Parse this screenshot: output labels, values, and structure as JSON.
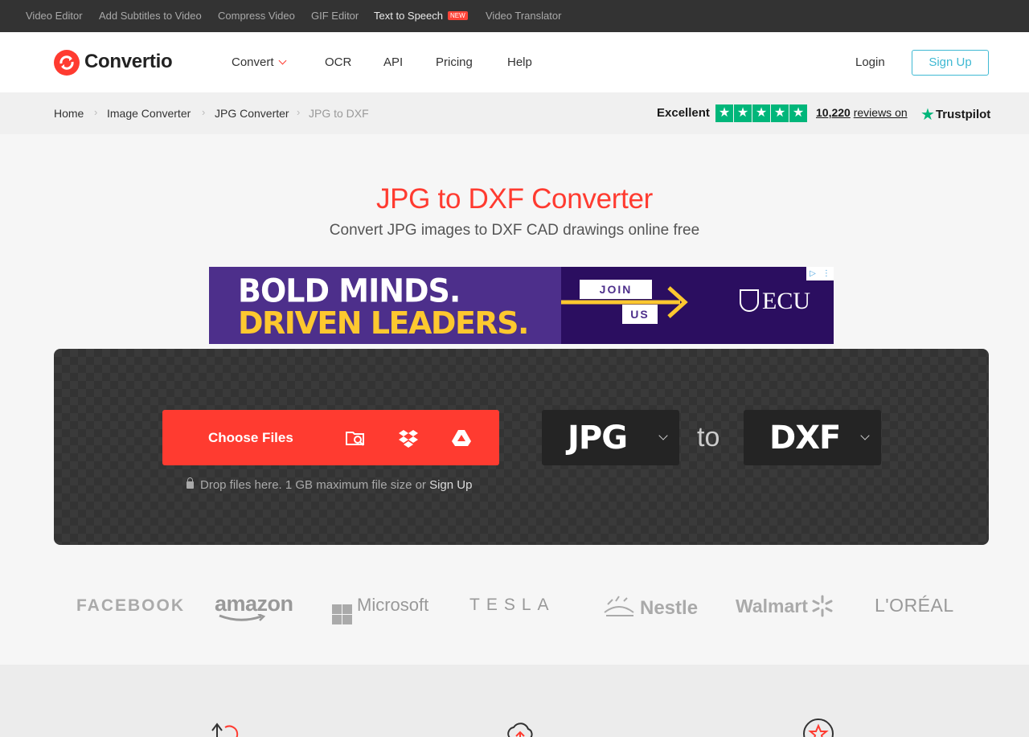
{
  "topbar": {
    "items": [
      {
        "label": "Video Editor"
      },
      {
        "label": "Add Subtitles to Video"
      },
      {
        "label": "Compress Video"
      },
      {
        "label": "GIF Editor"
      },
      {
        "label": "Text to Speech",
        "badge": "NEW"
      },
      {
        "label": "Video Translator"
      }
    ]
  },
  "header": {
    "logo_text": "Convertio",
    "nav": [
      {
        "label": "Convert"
      },
      {
        "label": "OCR"
      },
      {
        "label": "API"
      },
      {
        "label": "Pricing"
      },
      {
        "label": "Help"
      }
    ],
    "login_label": "Login",
    "signup_label": "Sign Up"
  },
  "breadcrumb": {
    "items": [
      {
        "label": "Home"
      },
      {
        "label": "Image Converter"
      },
      {
        "label": "JPG Converter"
      },
      {
        "label": "JPG to DXF"
      }
    ],
    "separator": "›"
  },
  "trustpilot": {
    "rating_word": "Excellent",
    "star_count": 5,
    "star_glyph": "★",
    "review_count": "10,220",
    "reviews_suffix": "reviews on",
    "brand": "Trustpilot",
    "brand_color": "#00b67a"
  },
  "hero": {
    "title": "JPG to DXF Converter",
    "subtitle": "Convert JPG images to DXF CAD drawings online free"
  },
  "ad": {
    "line1": "BOLD MINDS.",
    "line2": "DRIVEN LEADERS.",
    "join": "JOIN",
    "us": "US",
    "org": "ECU"
  },
  "converter": {
    "choose_label": "Choose Files",
    "source_icons": [
      "folder-search-icon",
      "dropbox-icon",
      "google-drive-icon"
    ],
    "drop_note": "Drop files here. 1 GB maximum file size or",
    "drop_signup": "Sign Up",
    "from_format": "JPG",
    "to_label": "to",
    "to_format": "DXF",
    "accent_color": "#ff3b30"
  },
  "brands": {
    "facebook": "FACEBOOK",
    "amazon": "amazon",
    "microsoft": "Microsoft",
    "tesla": "TESLA",
    "nestle": "Nestle",
    "walmart": "Walmart",
    "loreal": "L'ORÉAL"
  },
  "colors": {
    "accent": "#ff3b30",
    "signup_outline": "#3fb9d3",
    "topbar_bg": "#333333",
    "converter_bg": "#3a3a3a"
  }
}
